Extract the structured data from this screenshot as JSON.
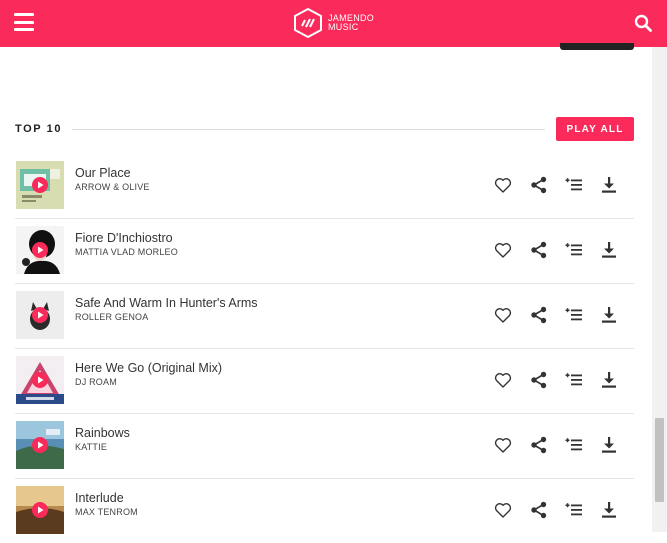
{
  "header": {
    "logo_line1": "JAMENDO",
    "logo_line2": "MUSIC",
    "brand_color": "#fa2a5a",
    "menu_icon": "hamburger-menu-icon",
    "search_icon": "search-icon"
  },
  "section": {
    "title": "TOP 10",
    "play_all_label": "PLAY ALL"
  },
  "tracks": [
    {
      "title": "Our Place",
      "artist": "ARROW & OLIVE"
    },
    {
      "title": "Fiore D'Inchiostro",
      "artist": "MATTIA VLAD MORLEO"
    },
    {
      "title": "Safe And Warm In Hunter's Arms",
      "artist": "ROLLER GENOA"
    },
    {
      "title": "Here We Go (Original Mix)",
      "artist": "DJ ROAM"
    },
    {
      "title": "Rainbows",
      "artist": "KATTIE"
    },
    {
      "title": "Interlude",
      "artist": "MAX TENROM"
    }
  ],
  "track_actions": [
    "heart-icon",
    "share-icon",
    "add-to-playlist-icon",
    "download-icon"
  ]
}
